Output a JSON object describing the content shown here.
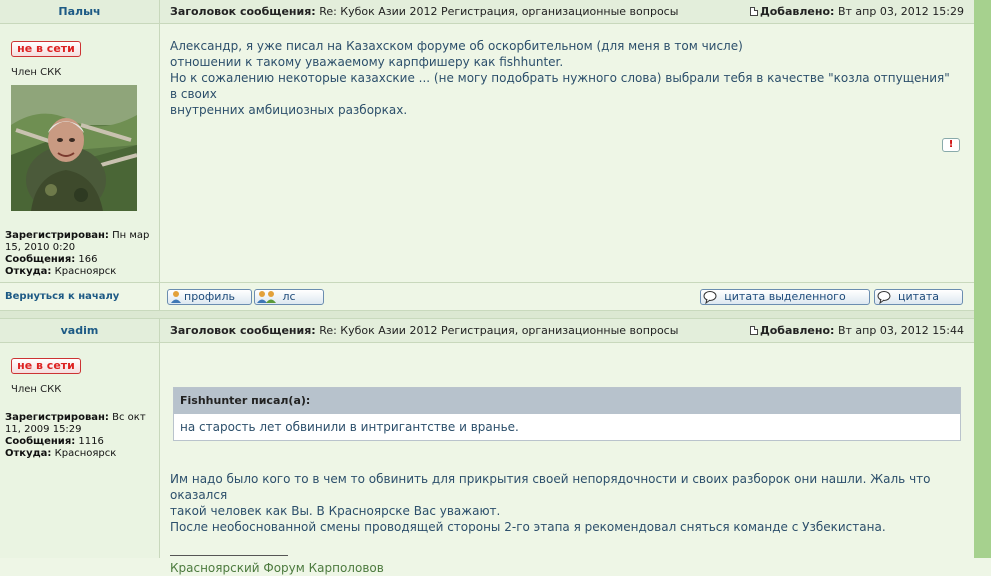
{
  "posts": [
    {
      "author": "Палыч",
      "subject_label": "Заголовок сообщения:",
      "subject": "Re: Кубок Азии 2012 Регистрация, организационные вопросы",
      "added_label": "Добавлено:",
      "added": "Вт апр 03, 2012 15:29",
      "status": "не в сети",
      "rank": "Член СКК",
      "registered_label": "Зарегистрирован:",
      "registered": "Пн мар 15, 2010 0:20",
      "posts_label": "Сообщения:",
      "posts_count": "166",
      "from_label": "Откуда:",
      "from": "Красноярск",
      "message_lines": [
        "Александр, я уже писал на Казахском форуме об оскорбительном (для меня в том числе)",
        "отношении к такому уважаемому карпфишеру как fishhunter.",
        "Но к сожалению некоторые казахские ... (не могу подобрать нужного слова) выбрали тебя в качестве \"козла отпущения\" в своих",
        "внутренних амбициозных разборках."
      ],
      "report_label": "!"
    },
    {
      "author": "vadim",
      "subject_label": "Заголовок сообщения:",
      "subject": "Re: Кубок Азии 2012 Регистрация, организационные вопросы",
      "added_label": "Добавлено:",
      "added": "Вт апр 03, 2012 15:44",
      "status": "не в сети",
      "rank": "Член СКК",
      "registered_label": "Зарегистрирован:",
      "registered": "Вс окт 11, 2009 15:29",
      "posts_label": "Сообщения:",
      "posts_count": "1116",
      "from_label": "Откуда:",
      "from": "Красноярск",
      "quote_header": "Fishhunter писал(а):",
      "quote_text": "на старость лет обвинили в интригантстве и вранье.",
      "message_lines": [
        "Им надо было кого то в чем то обвинить для прикрытия своей непорядочности и своих разборок они нашли. Жаль что оказался",
        "такой человек как Вы. В Красноярске Вас уважают.",
        "После необоснованной смены проводящей стороны 2-го этапа я рекомендовал сняться команде с Узбекистана."
      ],
      "signature": "Красноярский Форум Карполовов"
    }
  ],
  "footer": {
    "back_to_top": "Вернуться к началу",
    "profile": "профиль",
    "pm": "лс",
    "quote_selected": "цитата выделенного",
    "quote": "цитата"
  },
  "colors": {
    "background": "#eef6e6",
    "link": "#1d5a85",
    "offline": "#dd2222",
    "strip": "#a6d18e",
    "signature": "#4c7a3e"
  }
}
